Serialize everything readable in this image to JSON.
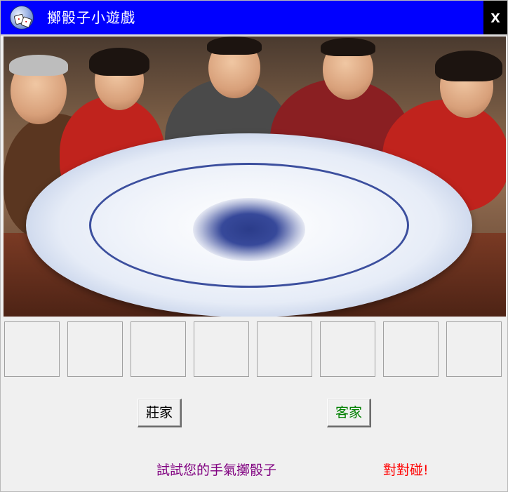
{
  "window": {
    "title": "擲骰子小遊戲",
    "close_label": "x",
    "icon": "dice-game-icon"
  },
  "scene": {
    "image": "family-around-porcelain-plate-photo"
  },
  "dice_slots": [
    "",
    "",
    "",
    "",
    "",
    "",
    "",
    ""
  ],
  "buttons": {
    "banker_label": "莊家",
    "player_label": "客家"
  },
  "status": {
    "prompt": "試試您的手氣擲骰子",
    "result": "對對碰!"
  },
  "colors": {
    "titlebar": "#0000ff",
    "close_bg": "#000000",
    "player_text": "#008000",
    "prompt_text": "#800080",
    "result_text": "#ff0000",
    "banker_text": "#000000"
  }
}
